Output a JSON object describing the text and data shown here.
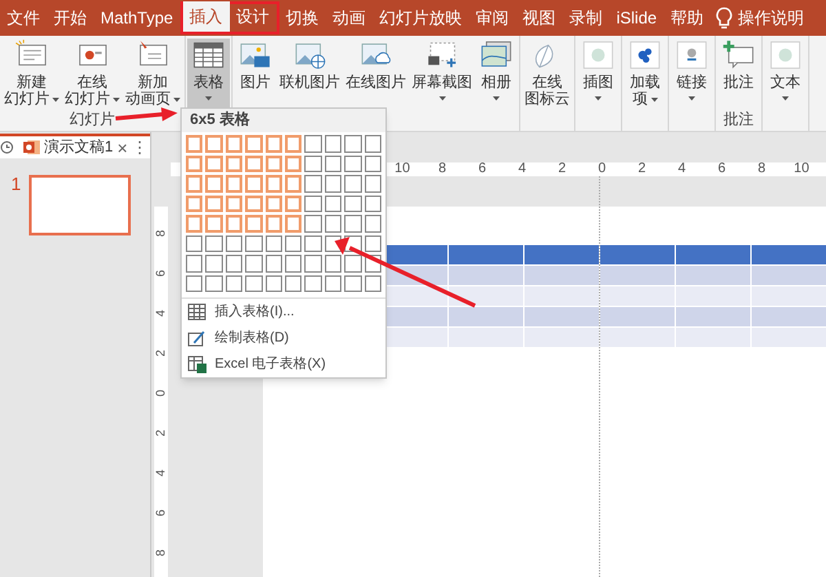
{
  "tabs": [
    {
      "label": "文件",
      "selected": false
    },
    {
      "label": "开始",
      "selected": false
    },
    {
      "label": "MathType",
      "selected": false
    },
    {
      "label": "插入",
      "selected": true,
      "boxed": true
    },
    {
      "label": "设计",
      "selected": false,
      "boxed": true
    },
    {
      "label": "切换",
      "selected": false
    },
    {
      "label": "动画",
      "selected": false
    },
    {
      "label": "幻灯片放映",
      "selected": false
    },
    {
      "label": "审阅",
      "selected": false
    },
    {
      "label": "视图",
      "selected": false
    },
    {
      "label": "录制",
      "selected": false
    },
    {
      "label": "iSlide",
      "selected": false
    },
    {
      "label": "帮助",
      "selected": false
    }
  ],
  "search_hint": "操作说明",
  "ribbon": {
    "groups": [
      {
        "label": "幻灯片",
        "buttons": [
          {
            "lines": [
              "新建",
              "幻灯片"
            ],
            "dropdown": true,
            "pressed": false
          },
          {
            "lines": [
              "在线",
              "幻灯片"
            ],
            "dropdown": true,
            "pressed": false
          },
          {
            "lines": [
              "新加",
              "动画页"
            ],
            "dropdown": true,
            "pressed": false
          }
        ]
      },
      {
        "buttons": [
          {
            "lines": [
              "表格"
            ],
            "dropdown": true,
            "pressed": true
          }
        ]
      },
      {
        "buttons": [
          {
            "lines": [
              "图片"
            ],
            "dropdown": false,
            "pressed": false
          },
          {
            "lines": [
              "联机图片"
            ],
            "dropdown": false,
            "pressed": false
          },
          {
            "lines": [
              "在线图片"
            ],
            "dropdown": false,
            "pressed": false
          },
          {
            "lines": [
              "屏幕截图"
            ],
            "dropdown": true,
            "pressed": false
          },
          {
            "lines": [
              "相册"
            ],
            "dropdown": true,
            "pressed": false
          }
        ]
      },
      {
        "buttons": [
          {
            "lines": [
              "在线",
              "图标云"
            ],
            "dropdown": false,
            "pressed": false
          }
        ]
      },
      {
        "buttons": [
          {
            "lines": [
              "插图"
            ],
            "dropdown": true,
            "pressed": false
          }
        ]
      },
      {
        "buttons": [
          {
            "lines": [
              "加载",
              "项"
            ],
            "dropdown": true,
            "pressed": false
          }
        ]
      },
      {
        "buttons": [
          {
            "lines": [
              "链接"
            ],
            "dropdown": true,
            "pressed": false
          }
        ]
      },
      {
        "label": "批注",
        "buttons": [
          {
            "lines": [
              "批注"
            ],
            "dropdown": false,
            "pressed": false
          }
        ]
      },
      {
        "buttons": [
          {
            "lines": [
              "文本"
            ],
            "dropdown": true,
            "pressed": false
          }
        ]
      }
    ]
  },
  "document_tab": {
    "title": "演示文稿1",
    "close": "×",
    "more": "⋮"
  },
  "slides": [
    {
      "number": "1",
      "selected": true
    }
  ],
  "table_menu": {
    "title": "6x5 表格",
    "grid": [
      [
        true,
        true,
        true,
        true,
        true,
        true,
        false,
        false,
        false,
        false
      ],
      [
        true,
        true,
        true,
        true,
        true,
        true,
        false,
        false,
        false,
        false
      ],
      [
        true,
        true,
        true,
        true,
        true,
        true,
        false,
        false,
        false,
        false
      ],
      [
        true,
        true,
        true,
        true,
        true,
        true,
        false,
        false,
        false,
        false
      ],
      [
        true,
        true,
        true,
        true,
        true,
        true,
        false,
        false,
        false,
        false
      ],
      [
        false,
        false,
        false,
        false,
        false,
        false,
        false,
        false,
        false,
        false
      ],
      [
        false,
        false,
        false,
        false,
        false,
        false,
        false,
        false,
        false,
        false
      ],
      [
        false,
        false,
        false,
        false,
        false,
        false,
        false,
        false,
        false,
        false
      ]
    ],
    "items": [
      "插入表格(I)...",
      "绘制表格(D)",
      "Excel 电子表格(X)"
    ]
  },
  "ruler": {
    "horizontal": [
      "10",
      "8",
      "6",
      "4",
      "2",
      "0",
      "2",
      "4",
      "6",
      "8",
      "10"
    ],
    "vertical": [
      "8",
      "6",
      "4",
      "2",
      "0",
      "2",
      "4",
      "6",
      "8"
    ]
  },
  "slide_table": {
    "rows": [
      {
        "kind": "header"
      },
      {
        "kind": "dark"
      },
      {
        "kind": "light"
      },
      {
        "kind": "dark"
      },
      {
        "kind": "light"
      }
    ]
  }
}
